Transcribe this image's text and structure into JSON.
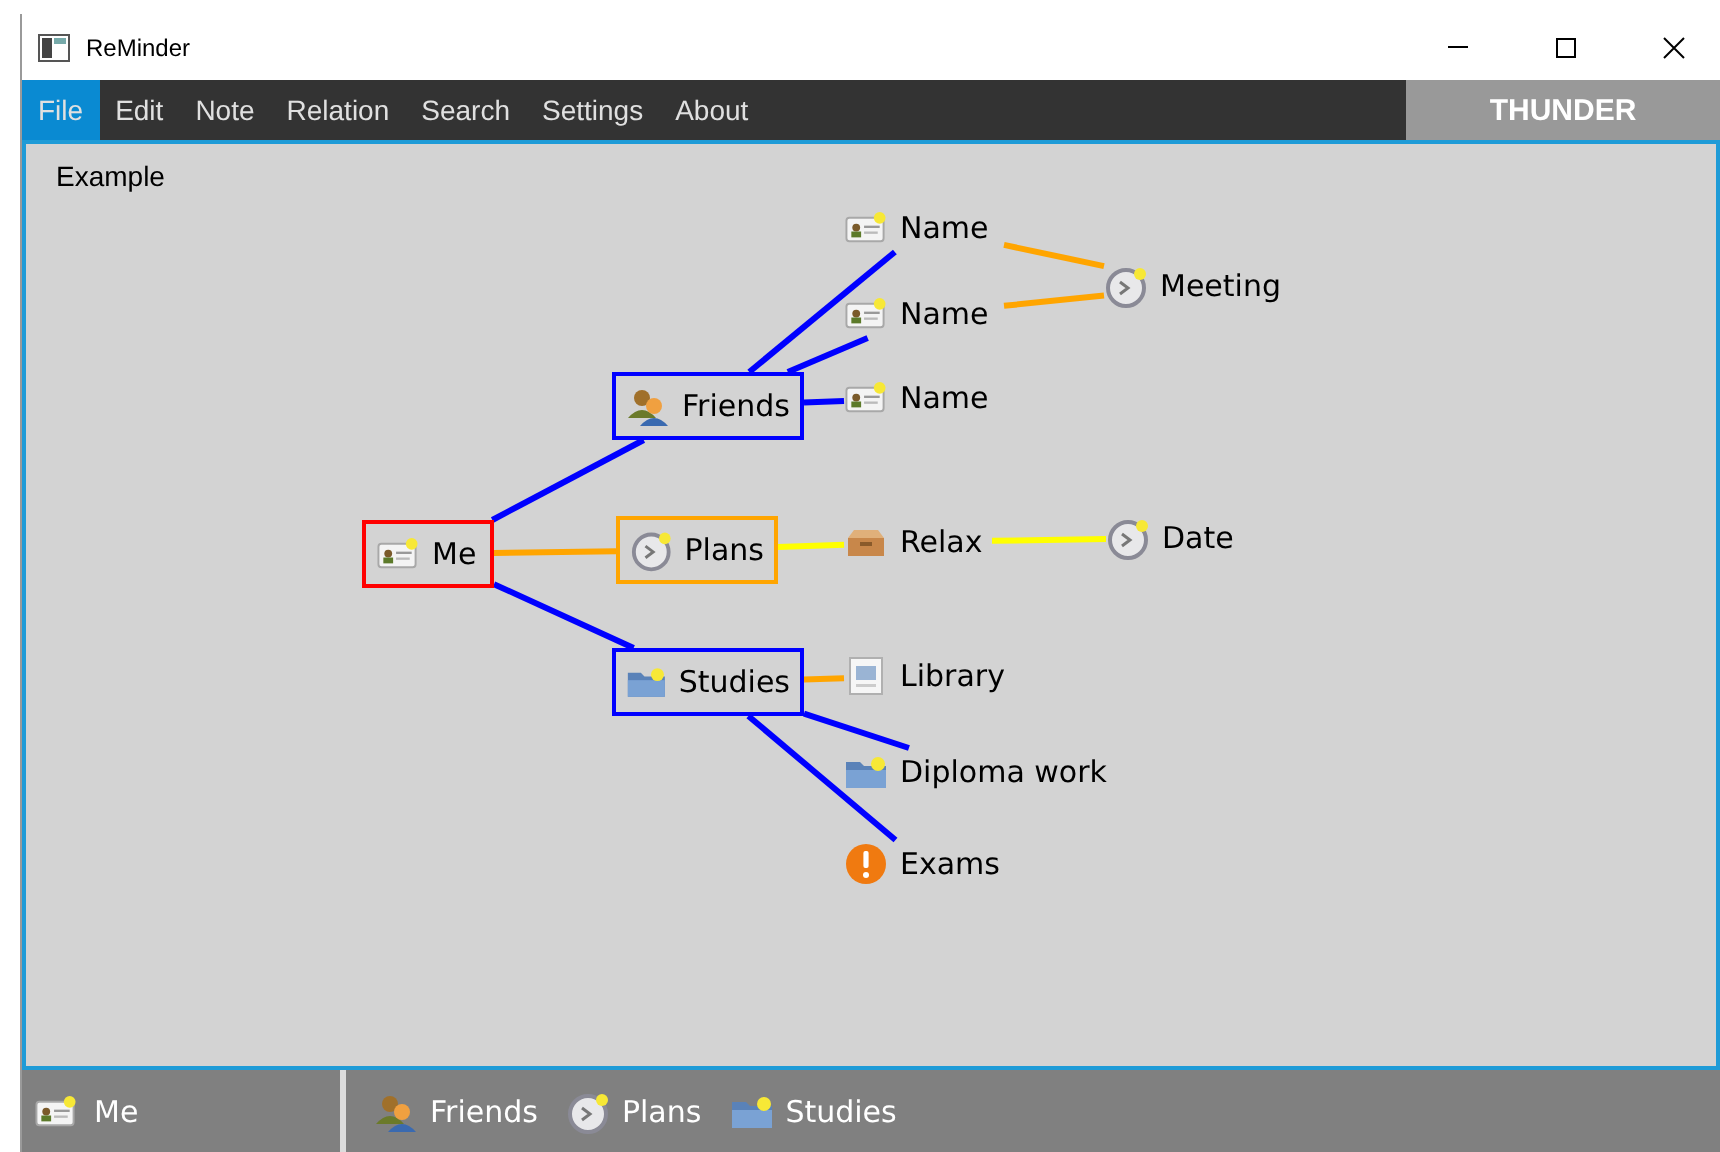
{
  "window": {
    "title": "ReMinder"
  },
  "menu": [
    {
      "label": "File",
      "selected": true
    },
    {
      "label": "Edit",
      "selected": false
    },
    {
      "label": "Note",
      "selected": false
    },
    {
      "label": "Relation",
      "selected": false
    },
    {
      "label": "Search",
      "selected": false
    },
    {
      "label": "Settings",
      "selected": false
    },
    {
      "label": "About",
      "selected": false
    }
  ],
  "user": "THUNDER",
  "canvas": {
    "title": "Example",
    "root": {
      "label": "Me",
      "kind": "card",
      "color": "#ff0000",
      "children": [
        {
          "label": "Friends",
          "kind": "people",
          "color": "#0000ff",
          "link": {
            "color": "#0000ff"
          },
          "children": [
            {
              "label": "Name",
              "kind": "card",
              "link": {
                "color": "#0000ff"
              },
              "children": [
                {
                  "label": "Meeting",
                  "kind": "clock",
                  "link": {
                    "color": "#ffa500"
                  }
                }
              ]
            },
            {
              "label": "Name",
              "kind": "card",
              "link": {
                "color": "#0000ff"
              },
              "joined": true
            },
            {
              "label": "Name",
              "kind": "card",
              "link": {
                "color": "#0000ff"
              }
            }
          ]
        },
        {
          "label": "Plans",
          "kind": "clock",
          "color": "#ffa500",
          "link": {
            "color": "#ffa500"
          },
          "children": [
            {
              "label": "Relax",
              "kind": "box",
              "link": {
                "color": "#ffff00"
              },
              "children": [
                {
                  "label": "Date",
                  "kind": "clock",
                  "link": {
                    "color": "#ffff00"
                  }
                }
              ]
            }
          ]
        },
        {
          "label": "Studies",
          "kind": "folder",
          "color": "#0000ff",
          "link": {
            "color": "#0000ff"
          },
          "children": [
            {
              "label": "Library",
              "kind": "document",
              "link": {
                "color": "#ffa500"
              }
            },
            {
              "label": "Diploma work",
              "kind": "folder",
              "link": {
                "color": "#0000ff"
              }
            },
            {
              "label": "Exams",
              "kind": "alert",
              "link": {
                "color": "#0000ff"
              }
            }
          ]
        }
      ]
    }
  },
  "status_bar": {
    "current": {
      "label": "Me",
      "kind": "card"
    },
    "path": [
      {
        "label": "Friends",
        "kind": "people"
      },
      {
        "label": "Plans",
        "kind": "clock"
      },
      {
        "label": "Studies",
        "kind": "folder"
      }
    ]
  }
}
